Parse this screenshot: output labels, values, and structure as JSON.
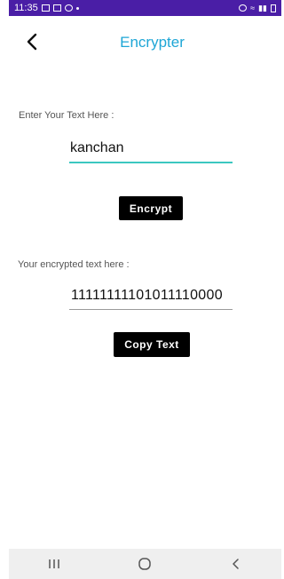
{
  "status_bar": {
    "time": "11:35",
    "bg_color": "#4a1ea6"
  },
  "app_bar": {
    "title": "Encrypter",
    "back_icon": "chevron-left-icon",
    "title_color": "#1ea6d6"
  },
  "input_section": {
    "label": "Enter Your Text Here :",
    "value": "kanchan",
    "underline_color": "#3cc7c0"
  },
  "encrypt_button": {
    "label": "Encrypt"
  },
  "output_section": {
    "label": "Your encrypted text here :",
    "value": "11111111101011110000",
    "underline_color": "#9a9a9a"
  },
  "copy_button": {
    "label": "Copy Text"
  },
  "nav_bar": {
    "recents_icon": "recents-icon",
    "home_icon": "home-icon",
    "back_icon": "back-icon"
  }
}
